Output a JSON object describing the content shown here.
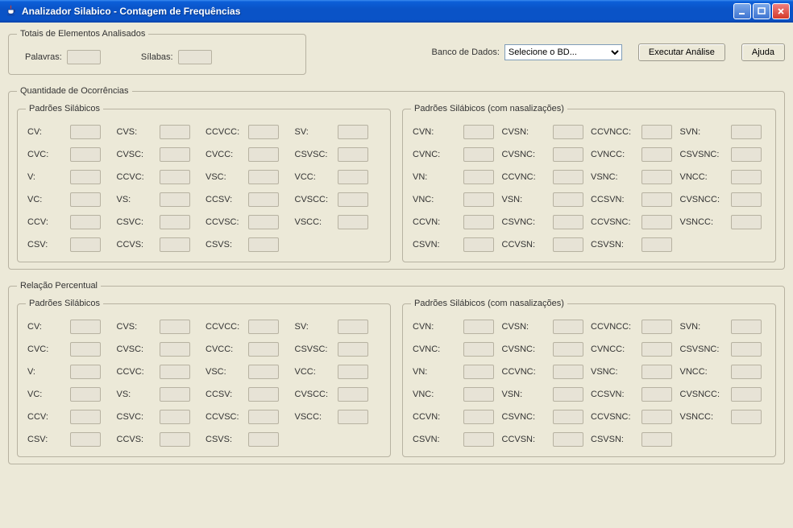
{
  "window": {
    "title": "Analizador Silabico - Contagem de Frequências"
  },
  "totals": {
    "legend": "Totais de Elementos Analisados",
    "palavras_label": "Palavras:",
    "palavras_value": "",
    "silabas_label": "Sílabas:",
    "silabas_value": ""
  },
  "db": {
    "label": "Banco de Dados:",
    "selected": "Selecione o BD..."
  },
  "buttons": {
    "execute": "Executar Análise",
    "help": "Ajuda"
  },
  "occ": {
    "legend": "Quantidade de Ocorrências",
    "pattern_legend": "Padrões Silábicos",
    "pattern_nasal_legend": "Padrões Silábicos (com nasalizações)"
  },
  "rel": {
    "legend": "Relação Percentual",
    "pattern_legend": "Padrões Silábicos",
    "pattern_nasal_legend": "Padrões Silábicos (com nasalizações)"
  },
  "patterns": {
    "c0": [
      "CV:",
      "CVC:",
      "V:",
      "VC:",
      "CCV:",
      "CSV:"
    ],
    "c1": [
      "CVS:",
      "CVSC:",
      "CCVC:",
      "VS:",
      "CSVC:",
      "CCVS:"
    ],
    "c2": [
      "CCVCC:",
      "CVCC:",
      "VSC:",
      "CCSV:",
      "CCVSC:",
      "CSVS:"
    ],
    "c3": [
      "SV:",
      "CSVSC:",
      "VCC:",
      "CVSCC:",
      "VSCC:"
    ]
  },
  "patterns_nasal": {
    "c0": [
      "CVN:",
      "CVNC:",
      "VN:",
      "VNC:",
      "CCVN:",
      "CSVN:"
    ],
    "c1": [
      "CVSN:",
      "CVSNC:",
      "CCVNC:",
      "VSN:",
      "CSVNC:",
      "CCVSN:"
    ],
    "c2": [
      "CCVNCC:",
      "CVNCC:",
      "VSNC:",
      "CCSVN:",
      "CCVSNC:",
      "CSVSN:"
    ],
    "c3": [
      "SVN:",
      "CSVSNC:",
      "VNCC:",
      "CVSNCC:",
      "VSNCC:"
    ]
  }
}
